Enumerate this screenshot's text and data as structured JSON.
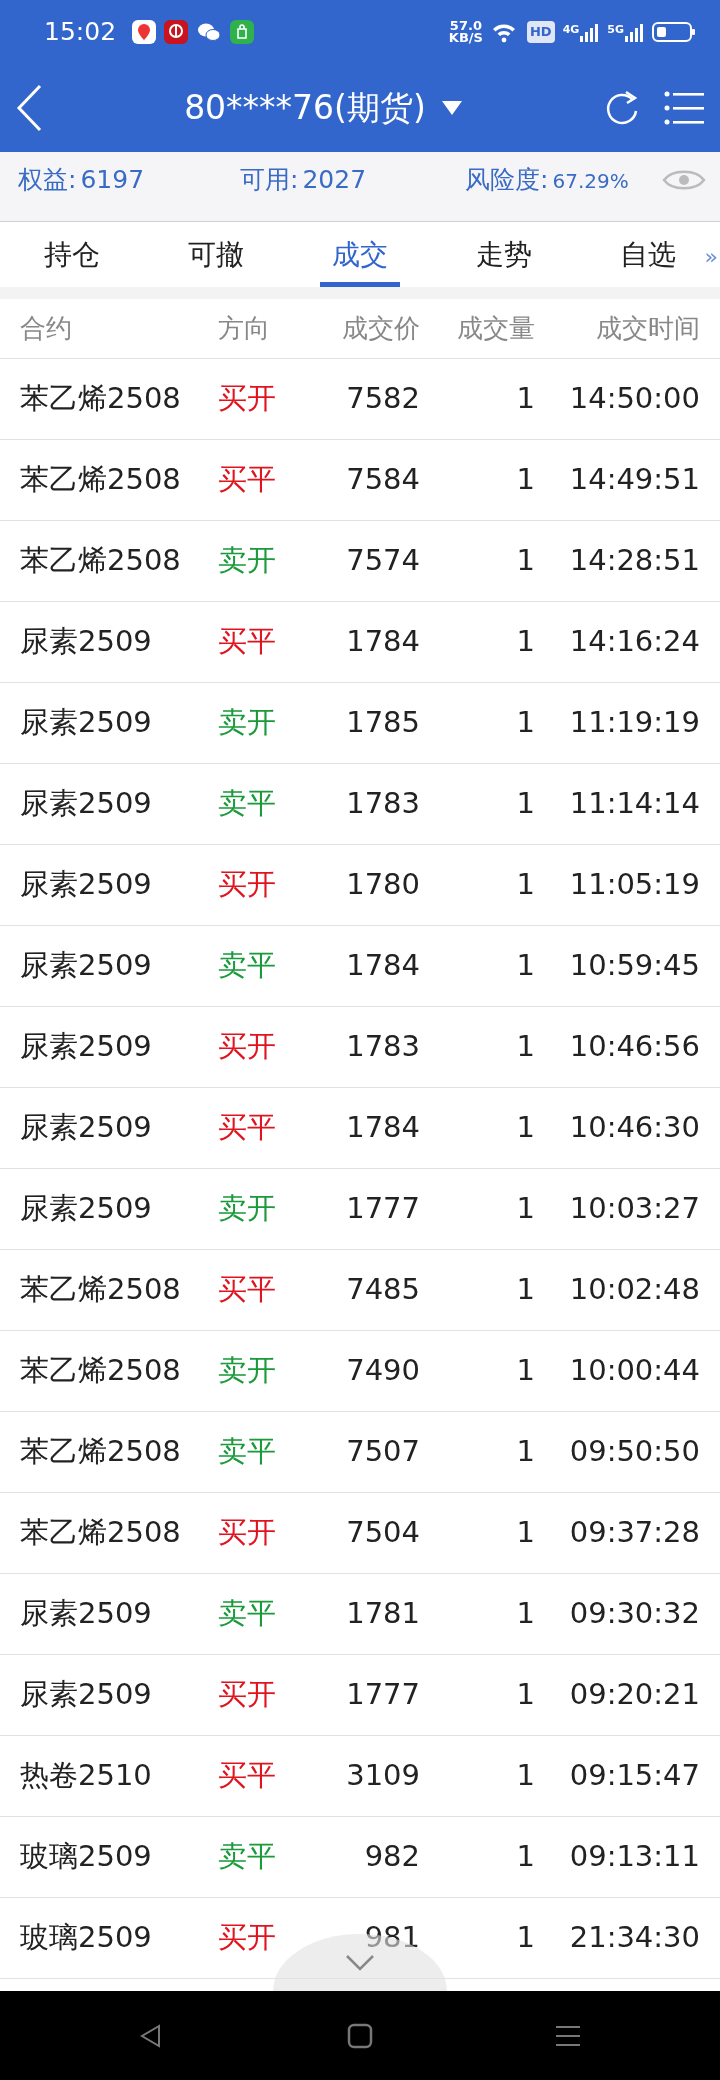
{
  "status_bar": {
    "time": "15:02",
    "speed": "57.0",
    "speed_unit": "KB/S",
    "hd": "HD",
    "net_1": "4G",
    "net_2": "5G"
  },
  "header": {
    "title": "80****76(期货)"
  },
  "visibility": {
    "on": true
  },
  "summary": [
    {
      "label": "权益:",
      "value": "6197"
    },
    {
      "label": "可用:",
      "value": "2027"
    },
    {
      "label": "风险度:",
      "value": "67.29%"
    }
  ],
  "tabs": [
    {
      "label": "持仓",
      "selected": false
    },
    {
      "label": "可撤",
      "selected": false
    },
    {
      "label": "成交",
      "selected": true
    },
    {
      "label": "走势",
      "selected": false
    },
    {
      "label": "自选",
      "selected": false
    }
  ],
  "more_tabs": "»",
  "table": {
    "columns": [
      "合约",
      "方向",
      "成交价",
      "成交量",
      "成交时间"
    ],
    "rows": [
      {
        "contract": "苯乙烯2508",
        "direction": "买开",
        "color": "#e0141e",
        "price": "7582",
        "volume": "1",
        "time": "14:50:00"
      },
      {
        "contract": "苯乙烯2508",
        "direction": "买平",
        "color": "#e0141e",
        "price": "7584",
        "volume": "1",
        "time": "14:49:51"
      },
      {
        "contract": "苯乙烯2508",
        "direction": "卖开",
        "color": "#1a9a3a",
        "price": "7574",
        "volume": "1",
        "time": "14:28:51"
      },
      {
        "contract": "尿素2509",
        "direction": "买平",
        "color": "#e0141e",
        "price": "1784",
        "volume": "1",
        "time": "14:16:24"
      },
      {
        "contract": "尿素2509",
        "direction": "卖开",
        "color": "#1a9a3a",
        "price": "1785",
        "volume": "1",
        "time": "11:19:19"
      },
      {
        "contract": "尿素2509",
        "direction": "卖平",
        "color": "#1a9a3a",
        "price": "1783",
        "volume": "1",
        "time": "11:14:14"
      },
      {
        "contract": "尿素2509",
        "direction": "买开",
        "color": "#e0141e",
        "price": "1780",
        "volume": "1",
        "time": "11:05:19"
      },
      {
        "contract": "尿素2509",
        "direction": "卖平",
        "color": "#1a9a3a",
        "price": "1784",
        "volume": "1",
        "time": "10:59:45"
      },
      {
        "contract": "尿素2509",
        "direction": "买开",
        "color": "#e0141e",
        "price": "1783",
        "volume": "1",
        "time": "10:46:56"
      },
      {
        "contract": "尿素2509",
        "direction": "买平",
        "color": "#e0141e",
        "price": "1784",
        "volume": "1",
        "time": "10:46:30"
      },
      {
        "contract": "尿素2509",
        "direction": "卖开",
        "color": "#1a9a3a",
        "price": "1777",
        "volume": "1",
        "time": "10:03:27"
      },
      {
        "contract": "苯乙烯2508",
        "direction": "买平",
        "color": "#e0141e",
        "price": "7485",
        "volume": "1",
        "time": "10:02:48"
      },
      {
        "contract": "苯乙烯2508",
        "direction": "卖开",
        "color": "#1a9a3a",
        "price": "7490",
        "volume": "1",
        "time": "10:00:44"
      },
      {
        "contract": "苯乙烯2508",
        "direction": "卖平",
        "color": "#1a9a3a",
        "price": "7507",
        "volume": "1",
        "time": "09:50:50"
      },
      {
        "contract": "苯乙烯2508",
        "direction": "买开",
        "color": "#e0141e",
        "price": "7504",
        "volume": "1",
        "time": "09:37:28"
      },
      {
        "contract": "尿素2509",
        "direction": "卖平",
        "color": "#1a9a3a",
        "price": "1781",
        "volume": "1",
        "time": "09:30:32"
      },
      {
        "contract": "尿素2509",
        "direction": "买开",
        "color": "#e0141e",
        "price": "1777",
        "volume": "1",
        "time": "09:20:21"
      },
      {
        "contract": "热卷2510",
        "direction": "买平",
        "color": "#e0141e",
        "price": "3109",
        "volume": "1",
        "time": "09:15:47"
      },
      {
        "contract": "玻璃2509",
        "direction": "卖平",
        "color": "#1a9a3a",
        "price": "982",
        "volume": "1",
        "time": "09:13:11"
      },
      {
        "contract": "玻璃2509",
        "direction": "买开",
        "color": "#e0141e",
        "price": "981",
        "volume": "1",
        "time": "21:34:30"
      }
    ]
  }
}
